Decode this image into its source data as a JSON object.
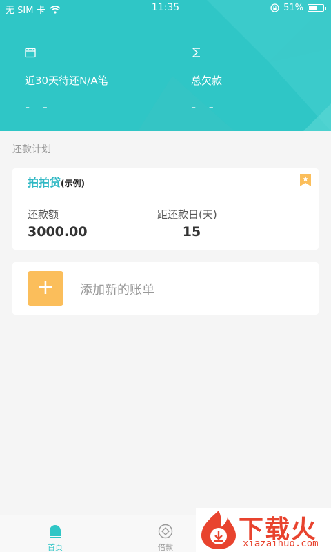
{
  "status_bar": {
    "carrier": "无 SIM 卡",
    "time": "11:35",
    "battery": "51%"
  },
  "summary": {
    "due_30": {
      "label": "近30天待还N/A笔",
      "value": "- -",
      "icon": "calendar-icon"
    },
    "total_debt": {
      "label": "总欠款",
      "value": "- -",
      "icon": "sigma-icon"
    }
  },
  "plan": {
    "section_title": "还款计划",
    "card": {
      "name": "拍拍贷",
      "tag": "(示例)",
      "amount_label": "还款额",
      "amount_value": "3000.00",
      "days_label": "距还款日(天)",
      "days_value": "15"
    },
    "add": {
      "icon": "+",
      "label": "添加新的账单"
    }
  },
  "tabbar": {
    "tabs": [
      {
        "label": "首页",
        "icon": "home-icon",
        "active": true
      },
      {
        "label": "借款",
        "icon": "loan-icon",
        "active": false
      }
    ]
  },
  "watermark": {
    "text": "下载火",
    "sub": "xiazaihuo.com"
  },
  "colors": {
    "primary": "#2fc6c6",
    "accent": "#fbbe5b",
    "watermark": "#e8432e"
  }
}
